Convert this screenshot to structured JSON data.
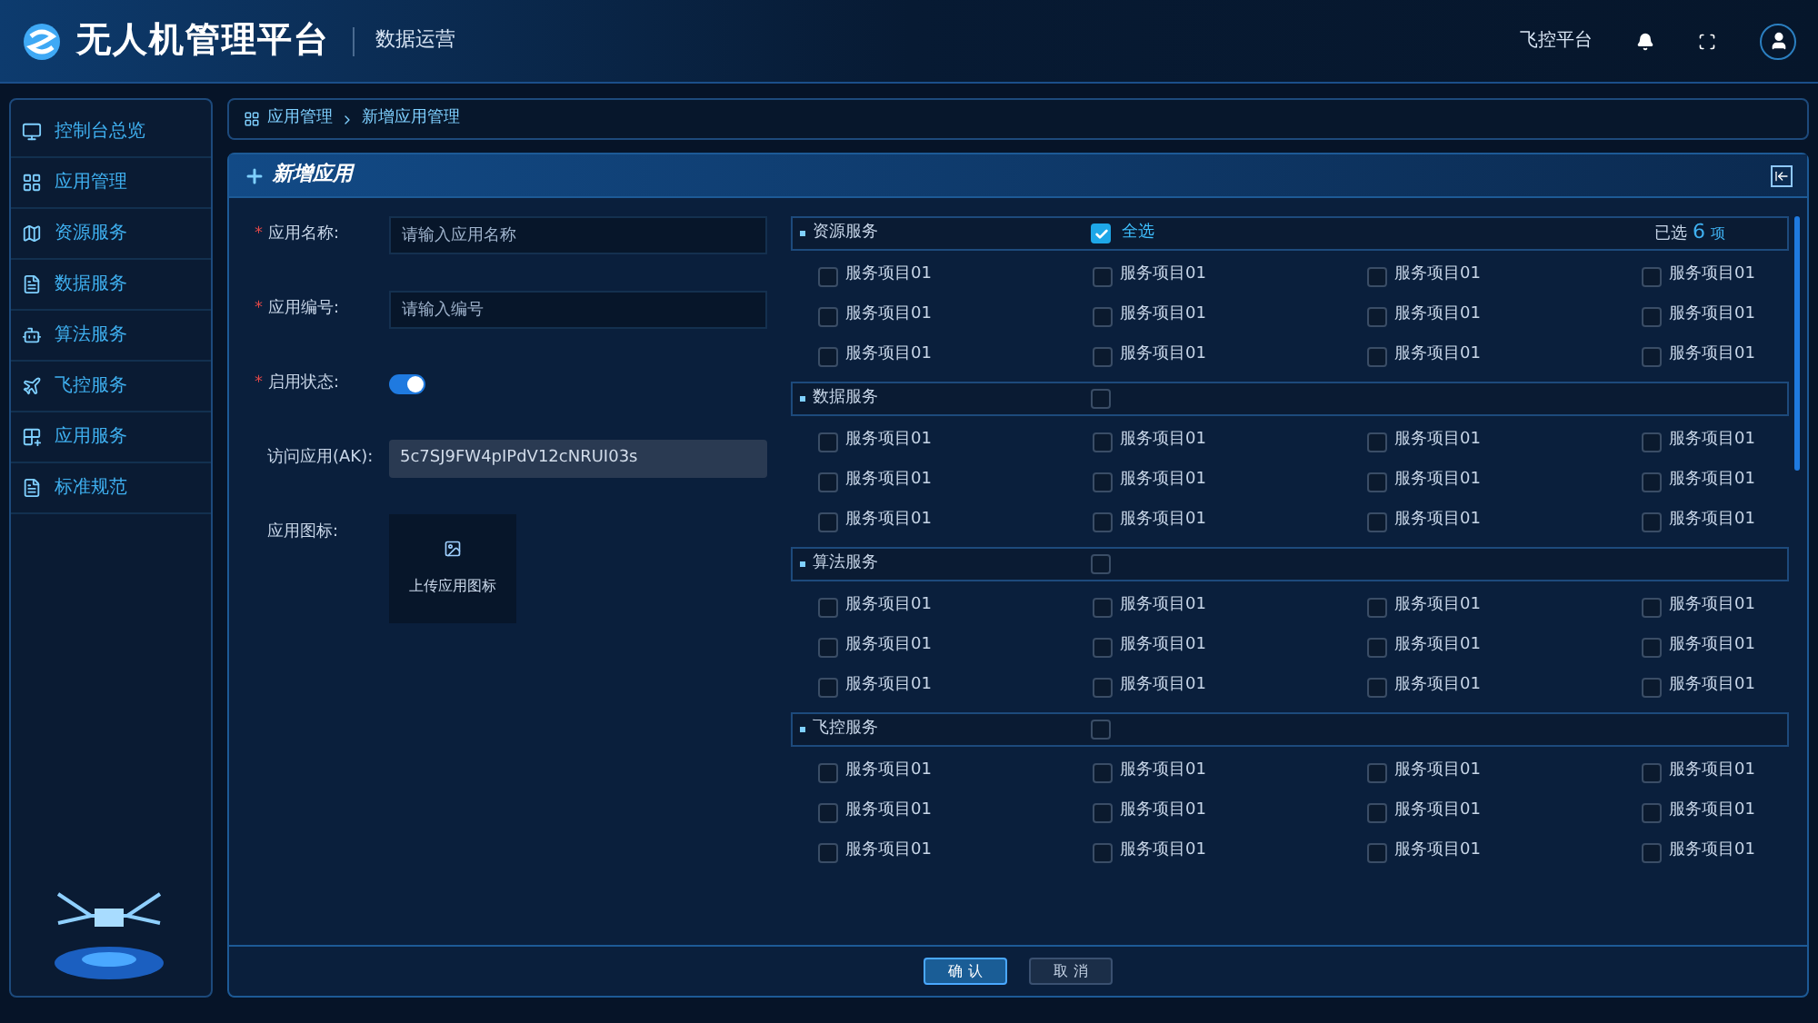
{
  "header": {
    "title": "无人机管理平台",
    "subtitle": "数据运营",
    "nav_link": "飞控平台"
  },
  "sidebar": {
    "items": [
      {
        "label": "控制台总览",
        "selected": false
      },
      {
        "label": "应用管理",
        "selected": false
      },
      {
        "label": "资源服务",
        "selected": false
      },
      {
        "label": "数据服务",
        "selected": false
      },
      {
        "label": "算法服务",
        "selected": false
      },
      {
        "label": "飞控服务",
        "selected": false
      },
      {
        "label": "应用服务",
        "selected": false
      },
      {
        "label": "标准规范",
        "selected": false
      }
    ]
  },
  "breadcrumb": [
    "应用管理",
    "新增应用管理"
  ],
  "panel": {
    "title": "新增应用"
  },
  "form": {
    "fields": [
      {
        "kind": "input",
        "label": "应用名称:",
        "required_mark": "*",
        "placeholder": "请输入应用名称"
      },
      {
        "kind": "input",
        "label": "应用编号:",
        "required_mark": "*",
        "placeholder": "请输入编号"
      },
      {
        "kind": "switch",
        "label": "启用状态:",
        "required_mark": "*",
        "on": true
      },
      {
        "kind": "readonly",
        "label": "访问应用(AK):",
        "value": "5c7SJ9FW4pIPdV12cNRUI03s"
      },
      {
        "kind": "upload",
        "label": "应用图标:",
        "text": "上传应用图标"
      }
    ]
  },
  "groups": [
    {
      "name": "资源服务",
      "checked": true,
      "select_all_label": "全选",
      "selected_label": "已选",
      "selected_count": "6",
      "selected_unit": "项",
      "items": [
        {
          "label": "服务项目01",
          "checked": false
        },
        {
          "label": "服务项目01",
          "checked": false
        },
        {
          "label": "服务项目01",
          "checked": false
        },
        {
          "label": "服务项目01",
          "checked": false
        },
        {
          "label": "服务项目01",
          "checked": false
        },
        {
          "label": "服务项目01",
          "checked": false
        },
        {
          "label": "服务项目01",
          "checked": false
        },
        {
          "label": "服务项目01",
          "checked": false
        },
        {
          "label": "服务项目01",
          "checked": false
        },
        {
          "label": "服务项目01",
          "checked": false
        },
        {
          "label": "服务项目01",
          "checked": false
        },
        {
          "label": "服务项目01",
          "checked": false
        }
      ]
    },
    {
      "name": "数据服务",
      "checked": false,
      "items": [
        {
          "label": "服务项目01",
          "checked": false
        },
        {
          "label": "服务项目01",
          "checked": false
        },
        {
          "label": "服务项目01",
          "checked": false
        },
        {
          "label": "服务项目01",
          "checked": false
        },
        {
          "label": "服务项目01",
          "checked": false
        },
        {
          "label": "服务项目01",
          "checked": false
        },
        {
          "label": "服务项目01",
          "checked": false
        },
        {
          "label": "服务项目01",
          "checked": false
        },
        {
          "label": "服务项目01",
          "checked": false
        },
        {
          "label": "服务项目01",
          "checked": false
        },
        {
          "label": "服务项目01",
          "checked": false
        },
        {
          "label": "服务项目01",
          "checked": false
        }
      ]
    },
    {
      "name": "算法服务",
      "checked": false,
      "items": [
        {
          "label": "服务项目01",
          "checked": false
        },
        {
          "label": "服务项目01",
          "checked": false
        },
        {
          "label": "服务项目01",
          "checked": false
        },
        {
          "label": "服务项目01",
          "checked": false
        },
        {
          "label": "服务项目01",
          "checked": false
        },
        {
          "label": "服务项目01",
          "checked": false
        },
        {
          "label": "服务项目01",
          "checked": false
        },
        {
          "label": "服务项目01",
          "checked": false
        },
        {
          "label": "服务项目01",
          "checked": false
        },
        {
          "label": "服务项目01",
          "checked": false
        },
        {
          "label": "服务项目01",
          "checked": false
        },
        {
          "label": "服务项目01",
          "checked": false
        }
      ]
    },
    {
      "name": "飞控服务",
      "checked": false,
      "items": [
        {
          "label": "服务项目01",
          "checked": false
        },
        {
          "label": "服务项目01",
          "checked": false
        },
        {
          "label": "服务项目01",
          "checked": false
        },
        {
          "label": "服务项目01",
          "checked": false
        },
        {
          "label": "服务项目01",
          "checked": false
        },
        {
          "label": "服务项目01",
          "checked": false
        },
        {
          "label": "服务项目01",
          "checked": false
        },
        {
          "label": "服务项目01",
          "checked": false
        },
        {
          "label": "服务项目01",
          "checked": false
        },
        {
          "label": "服务项目01",
          "checked": false
        },
        {
          "label": "服务项目01",
          "checked": false
        },
        {
          "label": "服务项目01",
          "checked": false
        }
      ]
    }
  ],
  "buttons": [
    {
      "label": "确 认",
      "kind": "primary"
    },
    {
      "label": "取 消",
      "kind": "secondary"
    }
  ]
}
